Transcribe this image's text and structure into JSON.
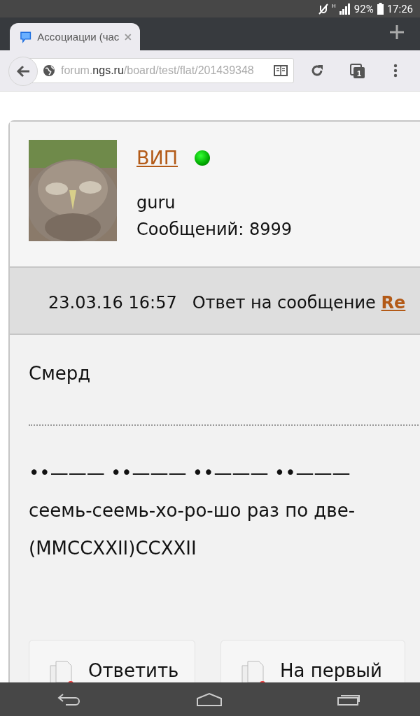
{
  "status_bar": {
    "battery": "92%",
    "time": "17:26",
    "network": "H"
  },
  "browser": {
    "tab": {
      "title": "Ассоциации (час",
      "selected": true
    },
    "url": {
      "host_prefix": "forum.",
      "domain": "ngs.ru",
      "path": "/board/test/flat/201439348"
    },
    "tab_count": "1"
  },
  "post": {
    "author": "ВИП",
    "online": true,
    "rank": "guru",
    "messages": "Сообщений: 8999",
    "date": "23.03.16 16:57",
    "reply_to": "Ответ на сообщение",
    "reply_link": "Re",
    "body": "Смерд",
    "signature": [
      "••——— ••——— ••——— ••———",
      "сеемь-сеемь-хо-ро-шо раз по две-",
      "(MMCCXXII)CCXXII"
    ],
    "buttons": [
      {
        "label": "Ответить"
      },
      {
        "label": "На первый"
      }
    ]
  }
}
